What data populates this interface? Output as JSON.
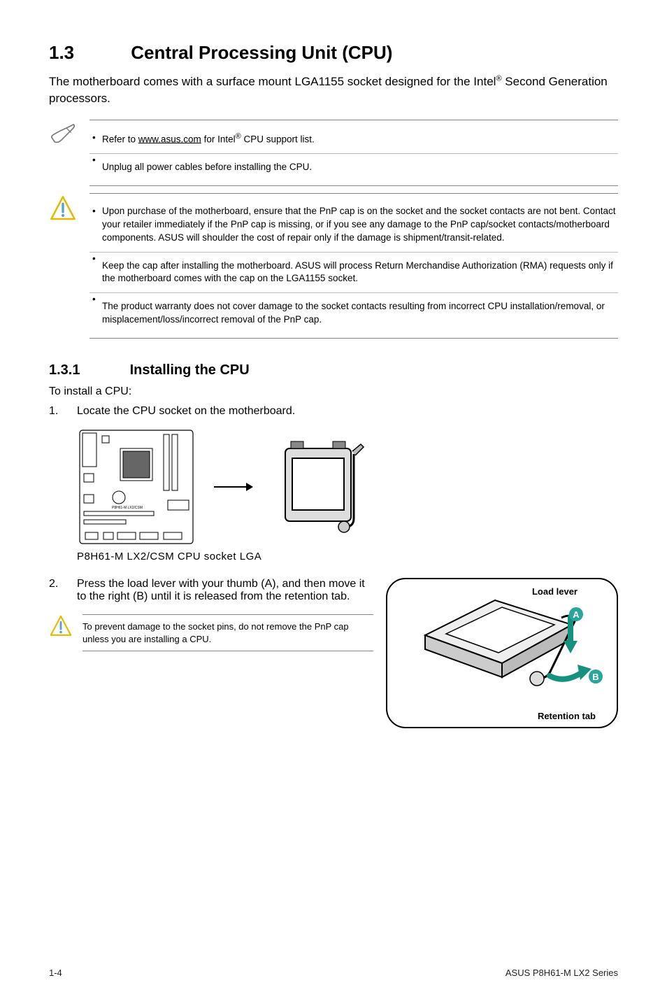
{
  "section": {
    "number": "1.3",
    "title": "Central Processing Unit (CPU)"
  },
  "intro": {
    "pre": "The motherboard comes with a surface mount LGA1155 socket designed for the Intel",
    "sup": "®",
    "post": " Second Generation processors."
  },
  "note1": {
    "items": [
      {
        "pre": "Refer to ",
        "link": "www.asus.com",
        "post_pre": " for Intel",
        "sup": "®",
        "post": " CPU support list."
      },
      {
        "text": "Unplug all power cables before installing the CPU."
      }
    ]
  },
  "warn1": {
    "items": [
      "Upon purchase of the motherboard, ensure that the PnP cap is on the socket and the socket contacts are not bent. Contact your retailer immediately if the PnP cap is missing, or if you see any damage to the PnP cap/socket contacts/motherboard components. ASUS will shoulder the cost of repair only if the damage is shipment/transit-related.",
      "Keep the cap after installing the motherboard. ASUS will process Return Merchandise Authorization (RMA) requests only if the motherboard comes with the cap on the LGA1155 socket.",
      "The product warranty does not cover damage to the socket contacts resulting from incorrect CPU installation/removal, or misplacement/loss/incorrect removal of the PnP cap."
    ]
  },
  "subsection": {
    "number": "1.3.1",
    "title": "Installing the CPU"
  },
  "body_text": "To install a CPU:",
  "steps": {
    "s1": {
      "n": "1.",
      "t": "Locate the CPU socket on the motherboard."
    },
    "s2": {
      "n": "2.",
      "t": "Press the load lever with your thumb (A), and then move it to the right (B) until it is released from the retention tab."
    }
  },
  "diagram": {
    "board_label": "P8H61-M LX2/CSM",
    "caption": "P8H61-M LX2/CSM CPU socket LGA"
  },
  "warn2": {
    "text": "To prevent damage to the socket pins, do not remove the PnP cap unless you are installing a CPU."
  },
  "socket_labels": {
    "lever": "Load lever",
    "tab": "Retention tab",
    "a": "A",
    "b": "B"
  },
  "footer": {
    "left": "1-4",
    "right": "ASUS P8H61-M LX2 Series"
  }
}
